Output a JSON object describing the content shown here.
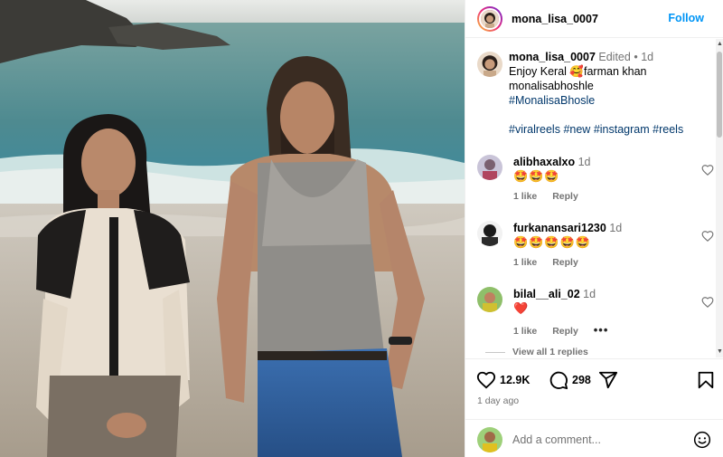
{
  "post": {
    "username": "mona_lisa_0007",
    "follow_label": "Follow"
  },
  "caption": {
    "username": "mona_lisa_0007",
    "edited": "Edited",
    "dot": "•",
    "age": "1d",
    "line1_text": "Enjoy Keral",
    "line1_emoji": "🥰",
    "line1_rest": "farman khan",
    "line2": "monalisabhoshle",
    "line3": "#MonalisaBhosle",
    "hashtags": [
      "#viralreels",
      "#new",
      "#instagram",
      "#reels"
    ]
  },
  "comments": [
    {
      "username": "alibhaxalxo",
      "age": "1d",
      "emojis": "🤩🤩🤩",
      "likes": "1 like",
      "reply": "Reply",
      "more": false
    },
    {
      "username": "furkanansari1230",
      "age": "1d",
      "emojis": "🤩🤩🤩🤩🤩",
      "likes": "1 like",
      "reply": "Reply",
      "more": false
    },
    {
      "username": "bilal__ali_02",
      "age": "1d",
      "emojis": "❤️",
      "likes": "1 like",
      "reply": "Reply",
      "more": true
    }
  ],
  "view_replies": "View all 1 replies",
  "actions": {
    "like_count": "12.9K",
    "comment_count": "298",
    "age": "1 day ago"
  },
  "add_comment": {
    "placeholder": "Add a comment..."
  },
  "icons": {
    "like": "heart-icon",
    "comment": "comment-icon",
    "share": "share-icon",
    "save": "bookmark-icon",
    "emoji": "smile-icon",
    "more": "more-icon"
  },
  "colors": {
    "follow": "#0095f6",
    "hashtag": "#00376b",
    "muted": "#737373"
  }
}
